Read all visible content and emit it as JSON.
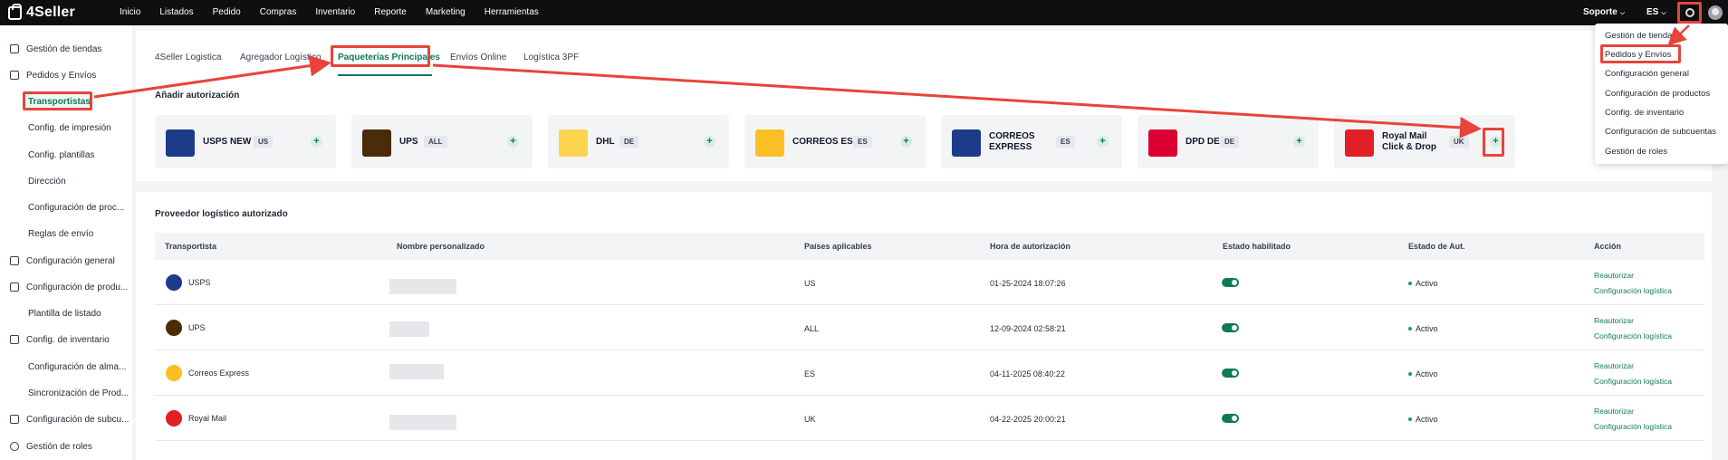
{
  "app": {
    "name": "4Seller"
  },
  "nav": [
    "Inicio",
    "Listados",
    "Pedido",
    "Compras",
    "Inventario",
    "Reporte",
    "Marketing",
    "Herramientas"
  ],
  "topbar": {
    "support": "Soporte",
    "lang": "ES"
  },
  "sidebar": {
    "items": [
      {
        "label": "Gestión de tiendas",
        "icon": "store-icon"
      },
      {
        "label": "Pedidos y Envíos",
        "icon": "orders-icon"
      },
      {
        "label": "Transportistas"
      },
      {
        "label": "Config. de impresión"
      },
      {
        "label": "Config. plantillas"
      },
      {
        "label": "Dirección"
      },
      {
        "label": "Configuración de proc..."
      },
      {
        "label": "Reglas de envío"
      },
      {
        "label": "Configuración general",
        "icon": "settings-icon"
      },
      {
        "label": "Configuración de produ...",
        "icon": "product-icon"
      },
      {
        "label": "Plantilla de listado"
      },
      {
        "label": "Config. de inventario",
        "icon": "inventory-icon"
      },
      {
        "label": "Configuración de alma..."
      },
      {
        "label": "Sincronización de Prod..."
      },
      {
        "label": "Configuración de subcu...",
        "icon": "subaccount-icon"
      },
      {
        "label": "Gestión de roles",
        "icon": "user-icon"
      }
    ]
  },
  "tabs": [
    "4Seller Logistica",
    "Agregador Logístico",
    "Paqueterías Principales",
    "Envíos Online",
    "Logística 3PF"
  ],
  "add_section": {
    "title": "Añadir autorización",
    "carriers": [
      {
        "name": "USPS NEW",
        "code": "US",
        "logo_color": "#1e3a8a"
      },
      {
        "name": "UPS",
        "code": "ALL",
        "logo_color": "#4a2c0a"
      },
      {
        "name": "DHL",
        "code": "DE",
        "logo_color": "#fcd34d"
      },
      {
        "name": "CORREOS ES",
        "code": "ES",
        "logo_color": "#fbbf24"
      },
      {
        "name": "CORREOS EXPRESS",
        "code": "ES",
        "logo_color": "#1e3a8a"
      },
      {
        "name": "DPD DE",
        "code": "DE",
        "logo_color": "#dc0032"
      },
      {
        "name": "Royal Mail Click & Drop",
        "code": "UK",
        "logo_color": "#e21f26"
      }
    ],
    "add_symbol": "+"
  },
  "table": {
    "title": "Proveedor logístico autorizado",
    "headers": [
      "Transportista",
      "Nombre personalizado",
      "Países aplicables",
      "Hora de autorización",
      "Estado habilitado",
      "Estado de Aut.",
      "Acción"
    ],
    "rows": [
      {
        "carrier": "USPS",
        "country": "US",
        "time": "01-25-2024 18:07:26",
        "status": "Activo",
        "logo_color": "#1e3a8a"
      },
      {
        "carrier": "UPS",
        "country": "ALL",
        "time": "12-09-2024 02:58:21",
        "status": "Activo",
        "logo_color": "#4a2c0a"
      },
      {
        "carrier": "Correos Express",
        "country": "ES",
        "time": "04-11-2025 08:40:22",
        "status": "Activo",
        "logo_color": "#fbbf24"
      },
      {
        "carrier": "Royal Mail",
        "country": "UK",
        "time": "04-22-2025 20:00:21",
        "status": "Activo",
        "logo_color": "#e21f26"
      }
    ],
    "action_reauth": "Reautorizar",
    "action_config": "Configuración logística"
  },
  "dropdown": {
    "items": [
      "Gestión de tiendas",
      "Pedidos y Envíos",
      "Configuración general",
      "Configuración de productos",
      "Config. de inventario",
      "Configuración de subcuentas",
      "Gestión de roles"
    ]
  },
  "colors": {
    "accent": "#0f7a5a",
    "highlight": "#e8443a"
  }
}
